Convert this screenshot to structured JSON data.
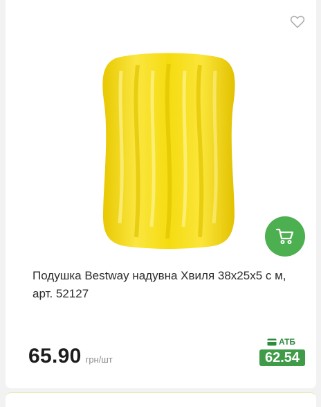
{
  "product": {
    "title": "Подушка Bestway надувна Хвиля 38x25x5 с м, арт. 52127",
    "image_icon": "inflatable-pillow-image",
    "price": "65.90",
    "unit": "грн/шт",
    "atb_label": "АТБ",
    "atb_price": "62.54"
  },
  "actions": {
    "favorite_icon": "heart-icon",
    "cart_icon": "cart-icon"
  },
  "colors": {
    "accent_green": "#4caf50",
    "atb_green": "#3f9b47",
    "product_yellow": "#f5dc00"
  }
}
